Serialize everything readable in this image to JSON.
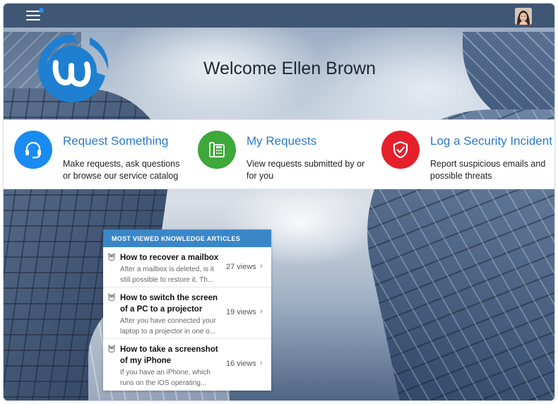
{
  "topbar": {
    "menu_icon": "hamburger-menu-icon",
    "notification_color": "#2b8cff",
    "avatar_icon": "user-avatar"
  },
  "brand": {
    "logo_icon": "brand-logo",
    "color": "#1e7fd1"
  },
  "welcome": {
    "title": "Welcome Ellen Brown"
  },
  "cards": [
    {
      "title": "Request Something",
      "description": "Make requests, ask questions or browse our service catalog",
      "icon": "headset-icon",
      "color": "#1a8bf0"
    },
    {
      "title": "My Requests",
      "description": "View requests submitted by or for you",
      "icon": "desk-phone-icon",
      "color": "#3ea83b"
    },
    {
      "title": "Log a Security Incident",
      "description": "Report suspicious emails and possible threats",
      "icon": "shield-check-icon",
      "color": "#e5202a"
    }
  ],
  "knowledge": {
    "header": "MOST VIEWED KNOWLEDGE ARTICLES",
    "header_color": "#3a87c8",
    "articles": [
      {
        "title": "How to recover a mailbox",
        "snippet": "After a mailbox is deleted, is it still possible to restore it. Th...",
        "views": "27 views"
      },
      {
        "title": "How to switch the screen of a PC to a projector",
        "snippet": "After you have connected your laptop to a projector in one o...",
        "views": "19 views"
      },
      {
        "title": "How to take a screenshot of my iPhone",
        "snippet": "If you have an iPhone, which runs on the iOS operating...",
        "views": "16 views"
      }
    ]
  }
}
